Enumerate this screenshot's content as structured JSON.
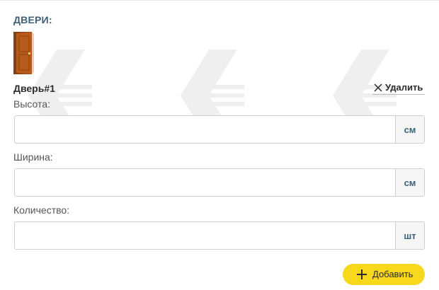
{
  "section": {
    "title": "ДВЕРИ:"
  },
  "door": {
    "title": "Дверь#1",
    "delete_label": "Удалить"
  },
  "fields": {
    "height": {
      "label": "Высота:",
      "value": "",
      "unit": "см"
    },
    "width": {
      "label": "Ширина:",
      "value": "",
      "unit": "см"
    },
    "quantity": {
      "label": "Количество:",
      "value": "",
      "unit": "шт"
    }
  },
  "add_button": {
    "label": "Добавить"
  },
  "colors": {
    "accent_yellow": "#f7d81d",
    "title_blue": "#3d6278",
    "door_brown": "#b85a1a"
  }
}
